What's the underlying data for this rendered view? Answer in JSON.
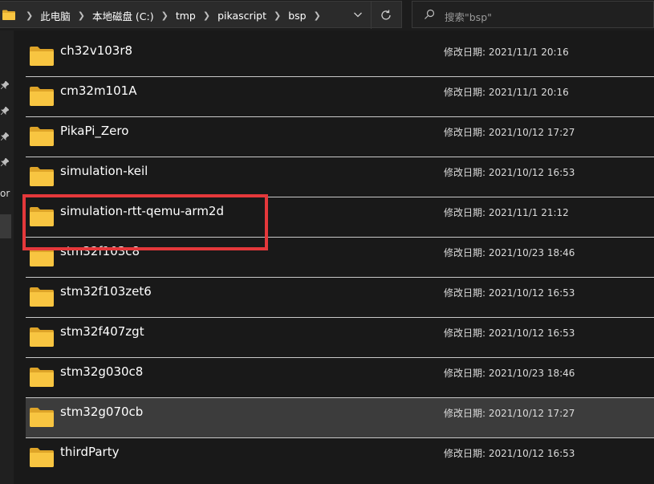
{
  "address_bar": {
    "breadcrumbs": [
      "此电脑",
      "本地磁盘 (C:)",
      "tmp",
      "pikascript",
      "bsp"
    ],
    "dropdown_icon": "chevron-down-icon",
    "refresh_icon": "refresh-icon"
  },
  "search": {
    "placeholder": "搜索\"bsp\"",
    "icon": "search-icon"
  },
  "left_pane": {
    "label_fragment": "or"
  },
  "files": [
    {
      "name": "ch32v103r8",
      "date": "修改日期: 2021/11/1 20:16"
    },
    {
      "name": "cm32m101A",
      "date": "修改日期: 2021/11/1 20:16"
    },
    {
      "name": "PikaPi_Zero",
      "date": "修改日期: 2021/10/12 17:27"
    },
    {
      "name": "simulation-keil",
      "date": "修改日期: 2021/10/12 16:53"
    },
    {
      "name": "simulation-rtt-qemu-arm2d",
      "date": "修改日期: 2021/11/1 21:12"
    },
    {
      "name": "stm32f103c8",
      "date": "修改日期: 2021/10/23 18:46"
    },
    {
      "name": "stm32f103zet6",
      "date": "修改日期: 2021/10/12 16:53"
    },
    {
      "name": "stm32f407zgt",
      "date": "修改日期: 2021/10/12 16:53"
    },
    {
      "name": "stm32g030c8",
      "date": "修改日期: 2021/10/23 18:46"
    },
    {
      "name": "stm32g070cb",
      "date": "修改日期: 2021/10/12 17:27"
    },
    {
      "name": "thirdParty",
      "date": "修改日期: 2021/10/12 16:53"
    }
  ],
  "hovered_item": "stm32g070cb",
  "annotated_item": "simulation-rtt-qemu-arm2d",
  "colors": {
    "background": "#191919",
    "folder": "#f8c541",
    "highlight": "#3c3c3c",
    "annotation": "#e5383b"
  }
}
